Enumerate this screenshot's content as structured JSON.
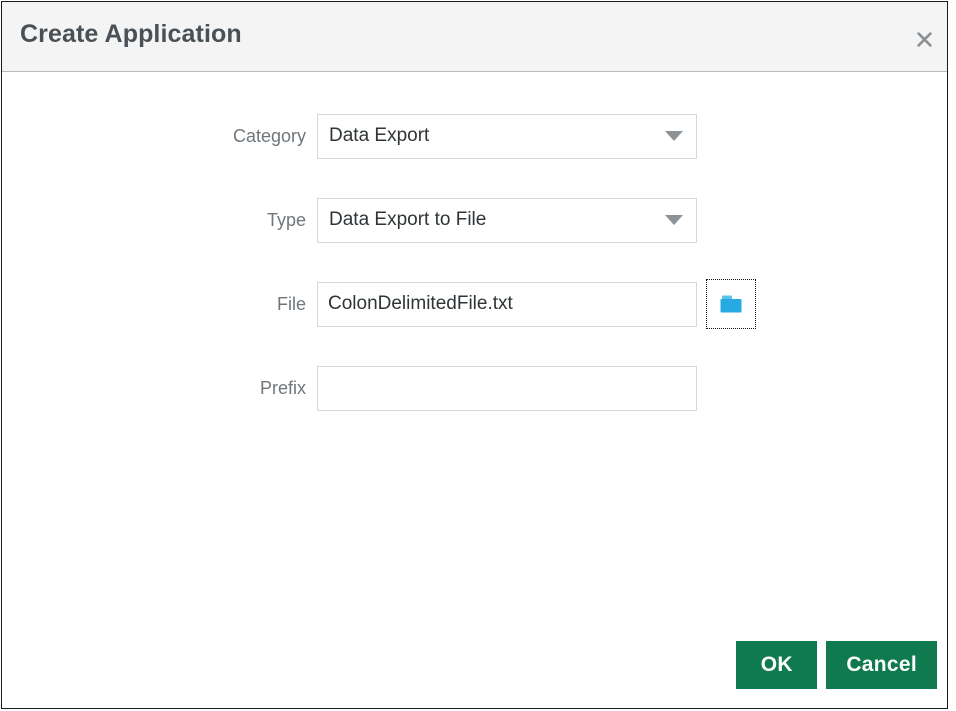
{
  "dialog": {
    "title": "Create Application",
    "close_icon": "close-icon",
    "accent_green": "#0e7a4d",
    "folder_icon_color": "#27a9e1"
  },
  "form": {
    "fields": [
      {
        "label": "Category",
        "type": "select",
        "value": "Data Export",
        "arrow_icon": "chevron-down-icon"
      },
      {
        "label": "Type",
        "type": "select",
        "value": "Data Export to File",
        "arrow_icon": "chevron-down-icon"
      },
      {
        "label": "File",
        "type": "text",
        "value": "ColonDelimitedFile.txt",
        "placeholder": "",
        "browse_icon": "folder-icon"
      },
      {
        "label": "Prefix",
        "type": "text",
        "value": "",
        "placeholder": ""
      }
    ]
  },
  "footer": {
    "ok_label": "OK",
    "cancel_label": "Cancel"
  }
}
